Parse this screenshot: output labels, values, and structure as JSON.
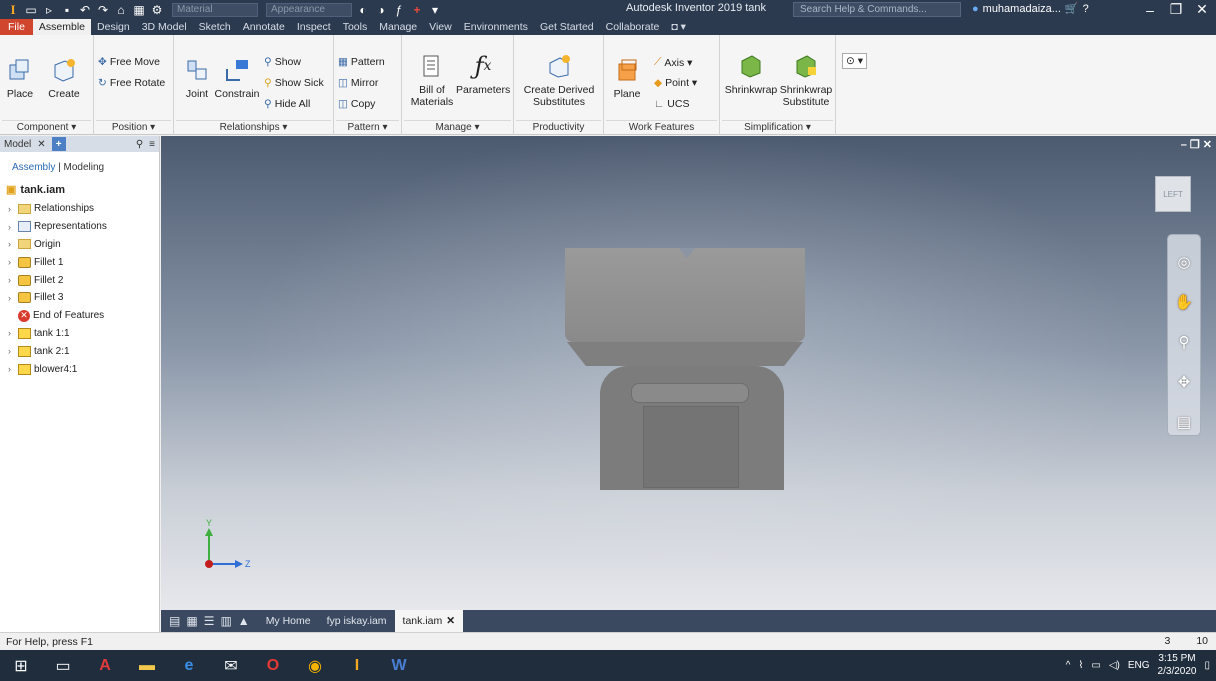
{
  "titlebar": {
    "material_placeholder": "Material",
    "appearance_placeholder": "Appearance",
    "app_title": "Autodesk Inventor 2019  tank",
    "search_placeholder": "Search Help & Commands...",
    "user": "muhamadaiza..."
  },
  "tabs": [
    "File",
    "Assemble",
    "Design",
    "3D Model",
    "Sketch",
    "Annotate",
    "Inspect",
    "Tools",
    "Manage",
    "View",
    "Environments",
    "Get Started",
    "Collaborate"
  ],
  "ribbon": {
    "component": {
      "place": "Place",
      "create": "Create",
      "label": "Component ▾"
    },
    "position": {
      "free_move": "Free Move",
      "free_rotate": "Free Rotate",
      "label": "Position ▾"
    },
    "relationships": {
      "joint": "Joint",
      "constrain": "Constrain",
      "show": "Show",
      "show_sick": "Show Sick",
      "hide_all": "Hide All",
      "label": "Relationships ▾"
    },
    "pattern": {
      "pattern": "Pattern",
      "mirror": "Mirror",
      "copy": "Copy",
      "label": "Pattern ▾"
    },
    "manage": {
      "bom_line1": "Bill of",
      "bom_line2": "Materials",
      "parameters": "Parameters",
      "label": "Manage ▾"
    },
    "productivity": {
      "cds_line1": "Create Derived",
      "cds_line2": "Substitutes",
      "label": "Productivity"
    },
    "work_features": {
      "plane": "Plane",
      "axis": "Axis ▾",
      "point": "Point ▾",
      "ucs": "UCS",
      "label": "Work Features"
    },
    "simplification": {
      "shrinkwrap": "Shrinkwrap",
      "shrinkwrap_sub_line1": "Shrinkwrap",
      "shrinkwrap_sub_line2": "Substitute",
      "label": "Simplification ▾"
    }
  },
  "browser": {
    "tab_label": "Model",
    "sub_assembly": "Assembly",
    "sub_modeling": "Modeling",
    "root": "tank.iam",
    "items": [
      {
        "label": "Relationships",
        "icon": "folder-icon"
      },
      {
        "label": "Representations",
        "icon": "representations-icon"
      },
      {
        "label": "Origin",
        "icon": "folder-icon"
      },
      {
        "label": "Fillet 1",
        "icon": "fillet-icon"
      },
      {
        "label": "Fillet 2",
        "icon": "fillet-icon"
      },
      {
        "label": "Fillet 3",
        "icon": "fillet-icon"
      },
      {
        "label": "End of Features",
        "icon": "end-of-features-icon"
      },
      {
        "label": "tank 1:1",
        "icon": "part-icon"
      },
      {
        "label": "tank 2:1",
        "icon": "part-icon"
      },
      {
        "label": "blower4:1",
        "icon": "part-icon"
      }
    ]
  },
  "viewport": {
    "viewcube_label": "LEFT",
    "triad_y": "Y",
    "triad_z": "Z"
  },
  "doctabs": {
    "tabs": [
      "My Home",
      "fyp iskay.iam",
      "tank.iam"
    ],
    "active": "tank.iam"
  },
  "statusbar": {
    "help": "For Help, press F1",
    "count1": "3",
    "count2": "10"
  },
  "taskbar": {
    "lang": "ENG",
    "time": "3:15 PM",
    "date": "2/3/2020"
  },
  "colors": {
    "titlebar_bg": "#2b3a4f",
    "file_tab": "#d0452e",
    "model_gray": "#7c7c7c"
  }
}
